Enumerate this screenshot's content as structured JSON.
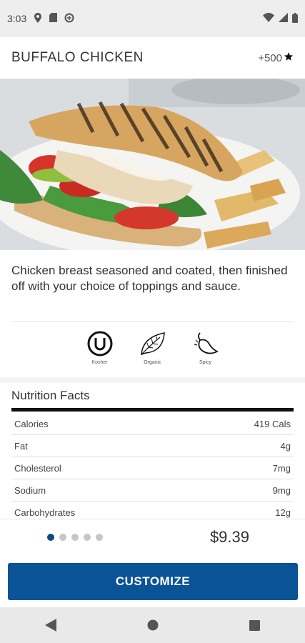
{
  "status_bar": {
    "time": "3:03",
    "left_icons": [
      "location-icon",
      "sim-card-icon",
      "sync-icon"
    ],
    "right_icons": [
      "wifi-icon",
      "cell-signal-icon",
      "battery-icon"
    ]
  },
  "header": {
    "title": "BUFFALO CHICKEN",
    "points": "+500",
    "points_icon": "star-icon"
  },
  "hero": {
    "icon": "sandwich-photo"
  },
  "description": "Chicken breast seasoned and coated, then finished off with your choice of toppings and sauce.",
  "diet_icons": [
    {
      "icon": "kosher-icon",
      "label": "Kosher"
    },
    {
      "icon": "organic-leaf-icon",
      "label": "Organic"
    },
    {
      "icon": "spicy-pepper-icon",
      "label": "Spicy"
    }
  ],
  "nutrition": {
    "title": "Nutrition Facts",
    "rows": [
      {
        "name": "Calories",
        "value": "419 Cals"
      },
      {
        "name": "Fat",
        "value": "4g"
      },
      {
        "name": "Cholesterol",
        "value": "7mg"
      },
      {
        "name": "Sodium",
        "value": "9mg"
      },
      {
        "name": "Carbohydrates",
        "value": "12g"
      }
    ]
  },
  "pagination": {
    "count": 5,
    "active_index": 0
  },
  "price": "$9.39",
  "customize_label": "CUSTOMIZE",
  "colors": {
    "primary": "#0a5396",
    "active_dot": "#0b4a8a"
  },
  "nav_bar": {
    "icons": [
      "back-icon",
      "home-icon",
      "recents-icon"
    ]
  }
}
